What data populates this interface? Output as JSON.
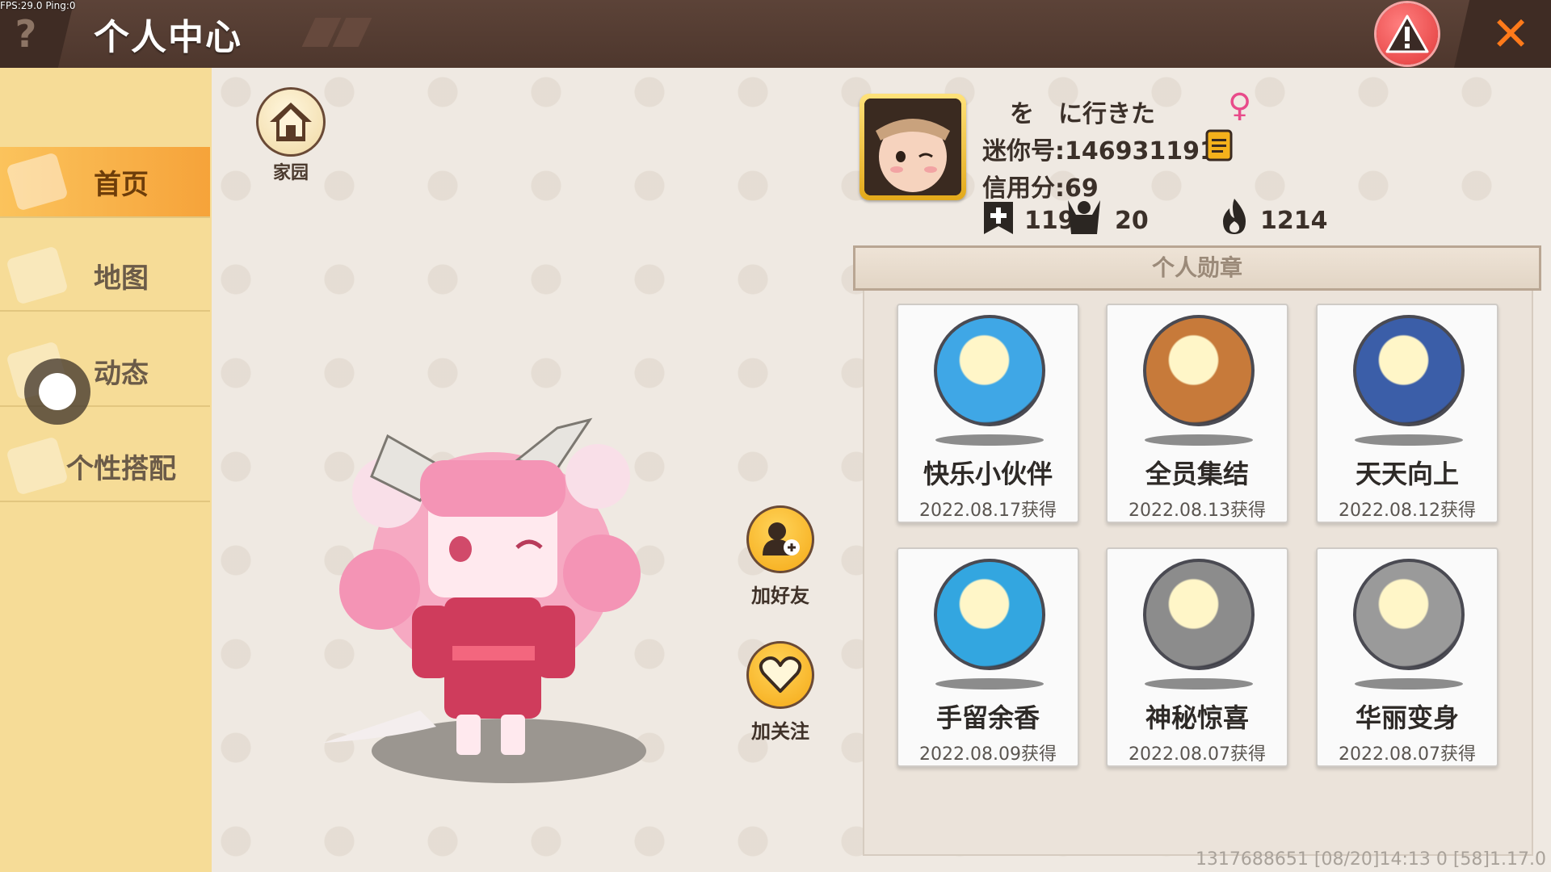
{
  "overlay": {
    "fps": "FPS:29.0  Ping:0"
  },
  "topbar": {
    "help_glyph": "?",
    "title": "个人中心",
    "close_glyph": "✕"
  },
  "sidebar": {
    "items": [
      {
        "label": "首页",
        "active": true
      },
      {
        "label": "地图",
        "active": false
      },
      {
        "label": "动态",
        "active": false
      },
      {
        "label": "个性搭配",
        "active": false
      }
    ]
  },
  "home": {
    "label": "家园"
  },
  "actions": {
    "add_friend": "加好友",
    "follow": "加关注"
  },
  "profile": {
    "name": "を　に行きた",
    "gender_symbol": "♀",
    "mini_id": "迷你号:1469311918",
    "credit": "信用分:69",
    "stats": {
      "count1": "119",
      "count2": "20",
      "count3": "1214"
    }
  },
  "medals": {
    "header": "个人勋章",
    "items": [
      {
        "name": "快乐小伙伴",
        "date": "2022.08.17获得",
        "color": "#3fa7e6"
      },
      {
        "name": "全员集结",
        "date": "2022.08.13获得",
        "color": "#c77a3a"
      },
      {
        "name": "天天向上",
        "date": "2022.08.12获得",
        "color": "#3b5ea8"
      },
      {
        "name": "手留余香",
        "date": "2022.08.09获得",
        "color": "#33a6e0"
      },
      {
        "name": "神秘惊喜",
        "date": "2022.08.07获得",
        "color": "#8c8c8c"
      },
      {
        "name": "华丽变身",
        "date": "2022.08.07获得",
        "color": "#9a9a9a"
      }
    ]
  },
  "footer": {
    "info": "1317688651   [08/20]14:13 0  [58]1.17.0"
  },
  "colors": {
    "accent_orange": "#f6a33a",
    "sidebar_bg": "#f6dc97",
    "topbar_bg": "#4e372d",
    "gender_pink": "#e84b8a"
  }
}
